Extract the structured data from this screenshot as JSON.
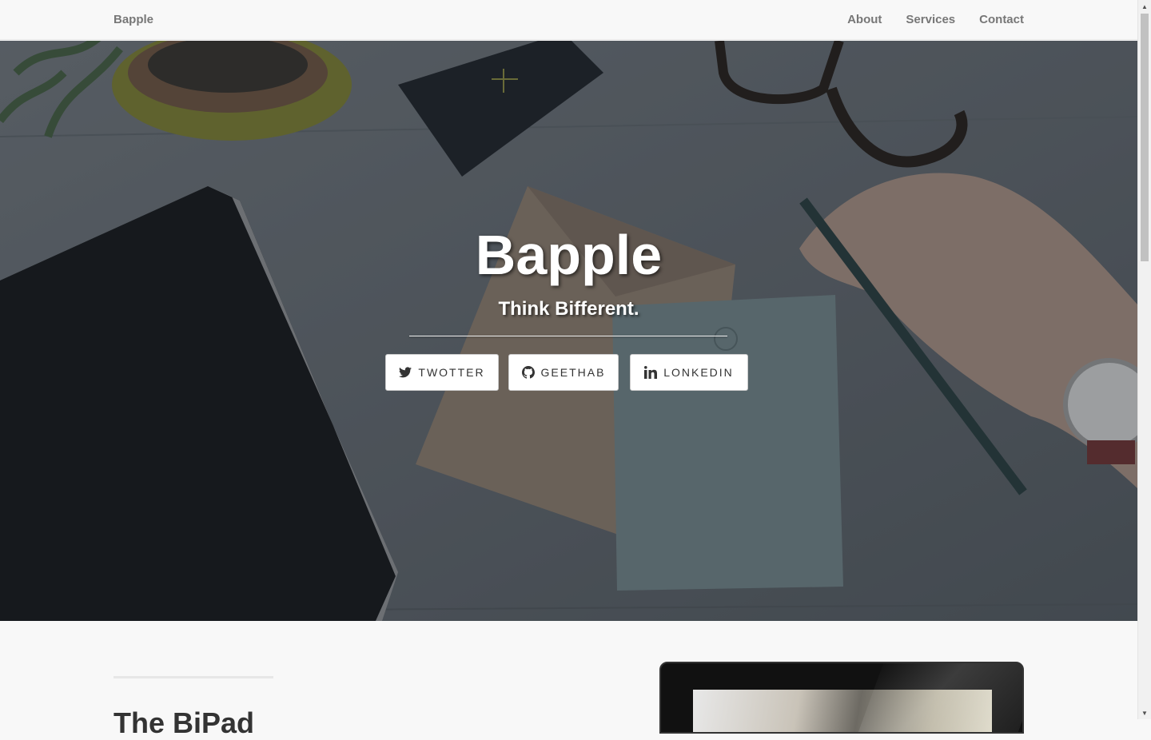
{
  "navbar": {
    "brand": "Bapple",
    "links": [
      "About",
      "Services",
      "Contact"
    ]
  },
  "hero": {
    "title": "Bapple",
    "subtitle": "Think Bifferent.",
    "buttons": [
      {
        "label": "TWOTTER",
        "icon": "twitter-icon"
      },
      {
        "label": "GEETHAB",
        "icon": "github-icon"
      },
      {
        "label": "LONKEDIN",
        "icon": "linkedin-icon"
      }
    ]
  },
  "section": {
    "heading": "The BiPad"
  },
  "colors": {
    "navbar_bg": "#f8f8f8",
    "nav_text": "#777777",
    "hero_overlay": "#4a5158",
    "button_bg": "#ffffff",
    "heading_text": "#333333"
  }
}
